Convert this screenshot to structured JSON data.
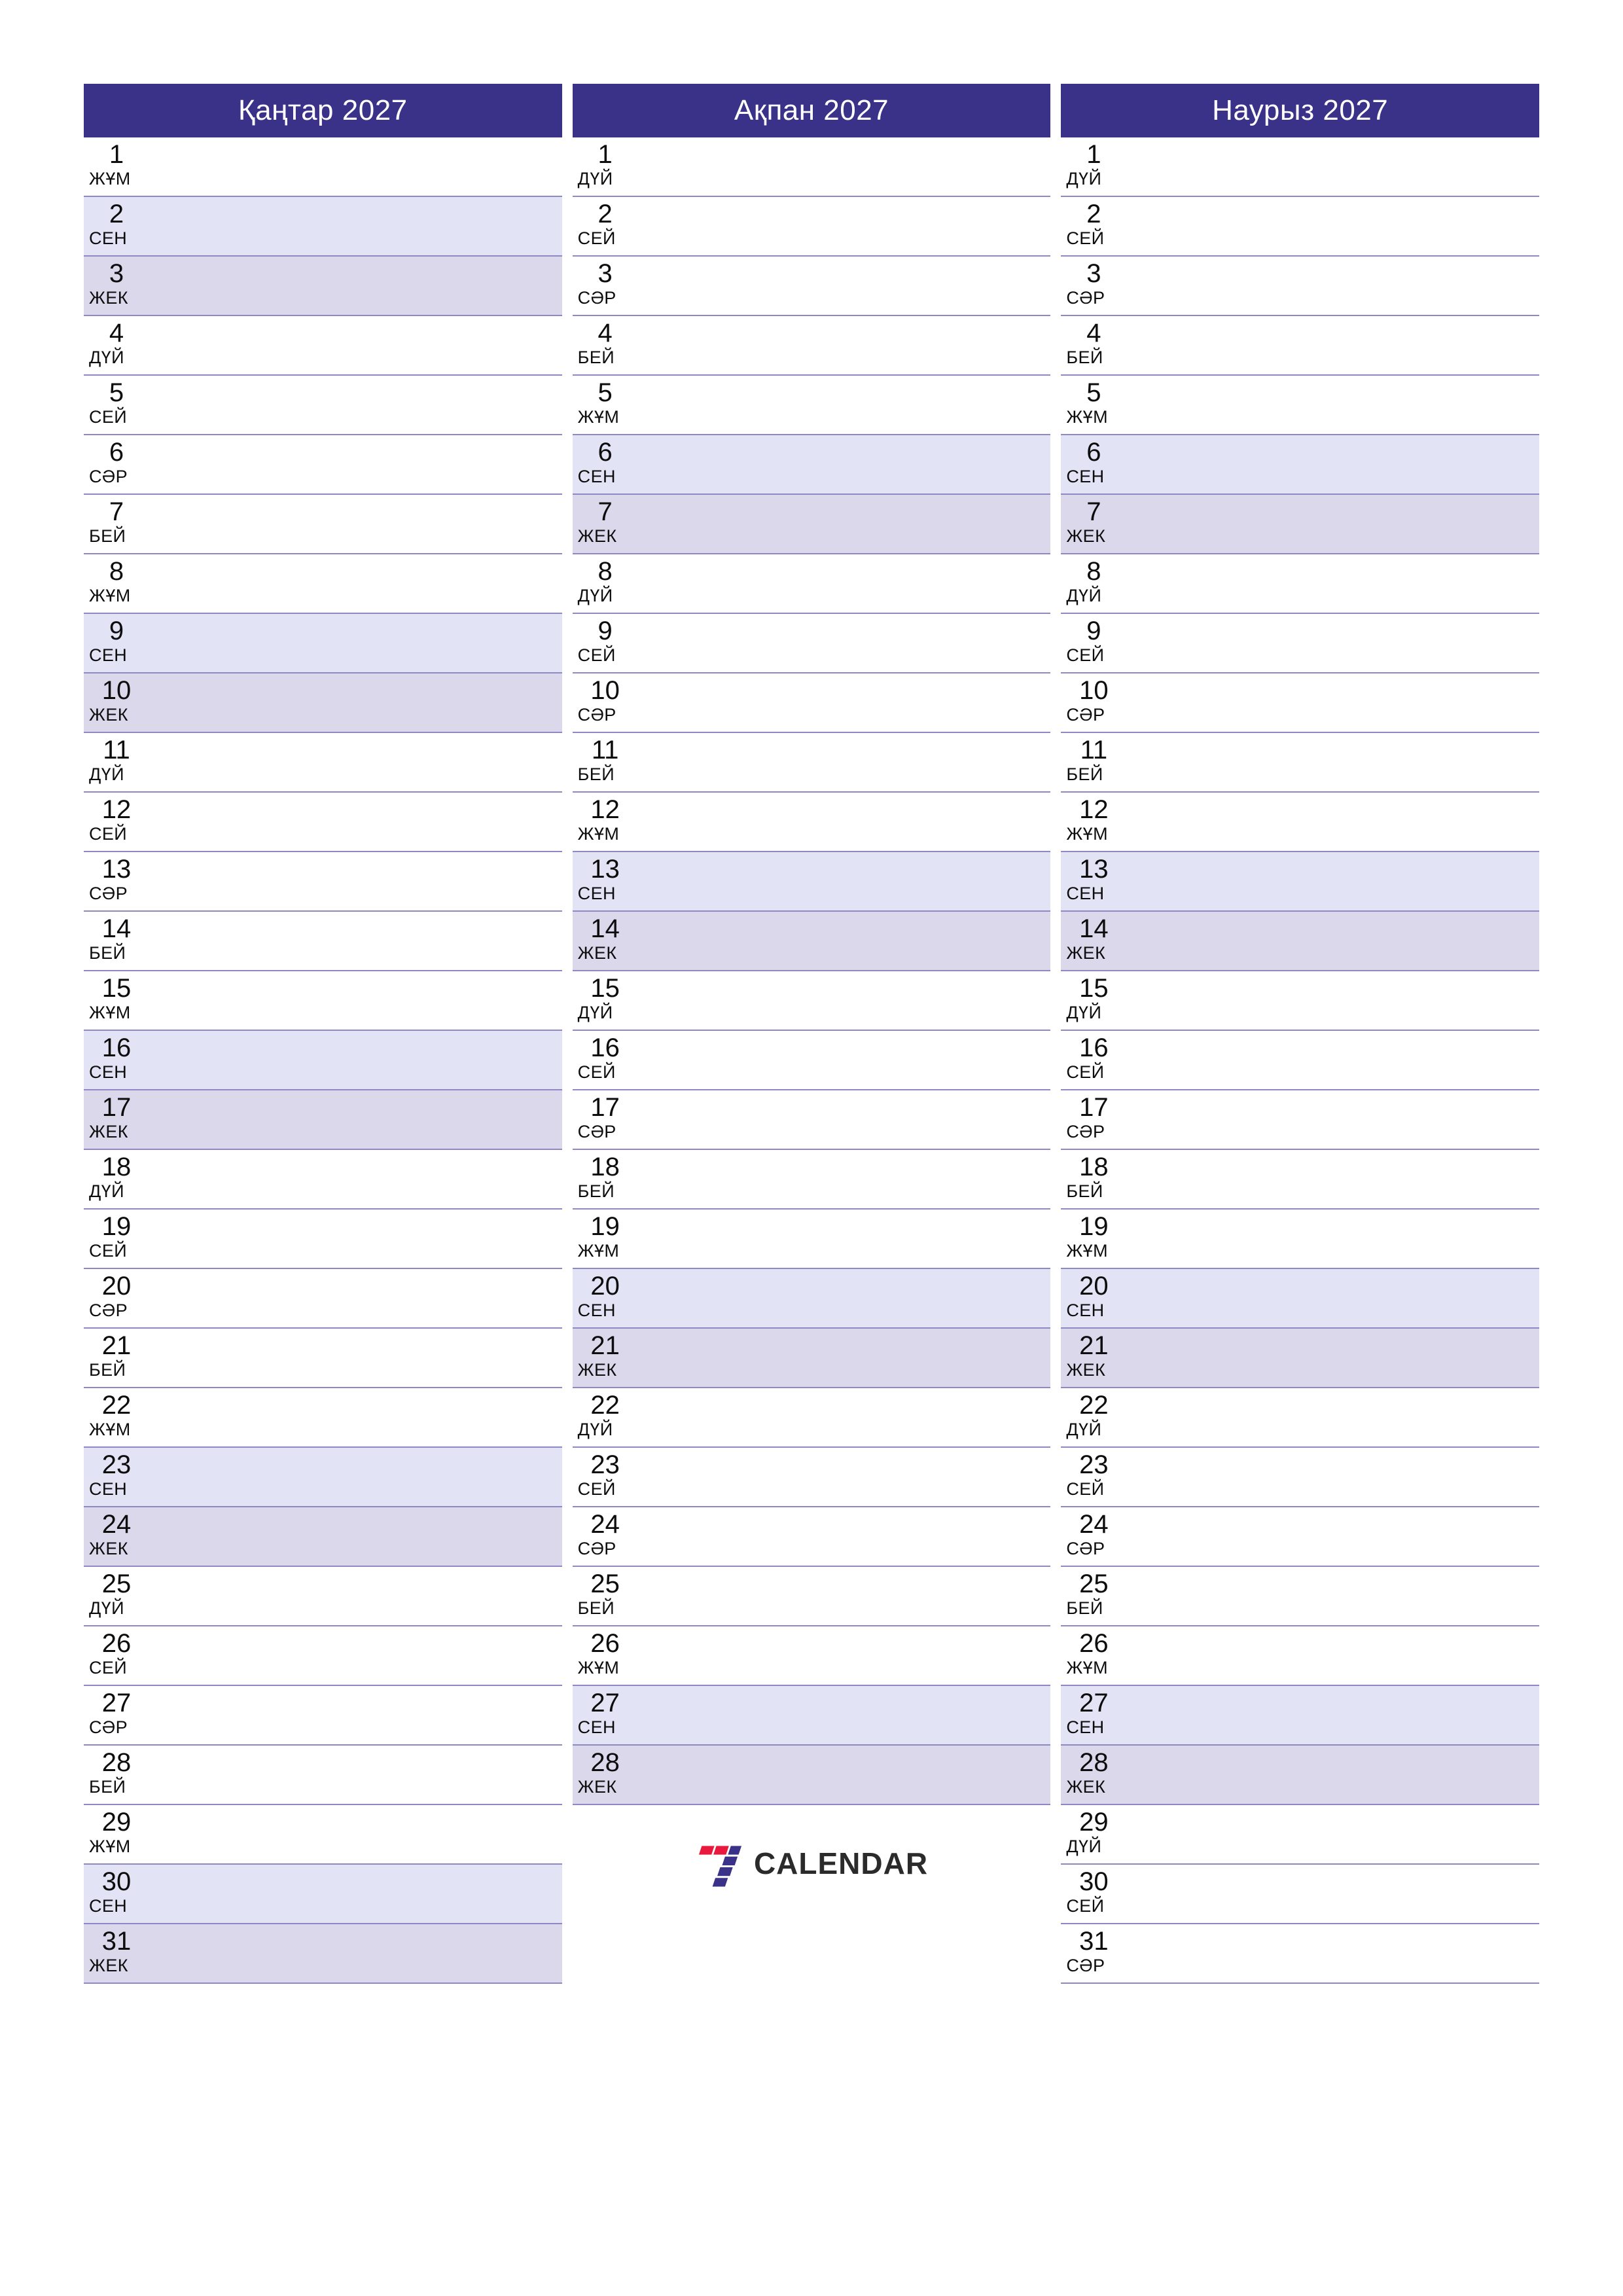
{
  "theme": {
    "header_bg": "#3a3189",
    "header_text": "#ffffff",
    "saturday_bg": "#e3e3f6",
    "sunday_bg": "#dcd8ec",
    "gridline": "#8e88c4",
    "day_text": "#0d0d0d",
    "logo_red": "#e8193c",
    "logo_purple": "#3a3189",
    "logo_text": "#2b2b2b"
  },
  "logo": {
    "mark_name": "seven-logo-mark",
    "text": "CALENDAR"
  },
  "weekday_names": {
    "mon": "ДҮЙ",
    "tue": "СЕЙ",
    "wed": "СӘР",
    "thu": "БЕЙ",
    "fri": "ЖҰМ",
    "sat": "СЕН",
    "sun": "ЖЕК"
  },
  "months": [
    {
      "id": "january",
      "title": "Қаңтар 2027",
      "days": [
        {
          "n": "1",
          "wd": "ЖҰМ",
          "type": "weekday"
        },
        {
          "n": "2",
          "wd": "СЕН",
          "type": "sat"
        },
        {
          "n": "3",
          "wd": "ЖЕК",
          "type": "sun"
        },
        {
          "n": "4",
          "wd": "ДҮЙ",
          "type": "weekday"
        },
        {
          "n": "5",
          "wd": "СЕЙ",
          "type": "weekday"
        },
        {
          "n": "6",
          "wd": "СӘР",
          "type": "weekday"
        },
        {
          "n": "7",
          "wd": "БЕЙ",
          "type": "weekday"
        },
        {
          "n": "8",
          "wd": "ЖҰМ",
          "type": "weekday"
        },
        {
          "n": "9",
          "wd": "СЕН",
          "type": "sat"
        },
        {
          "n": "10",
          "wd": "ЖЕК",
          "type": "sun"
        },
        {
          "n": "11",
          "wd": "ДҮЙ",
          "type": "weekday"
        },
        {
          "n": "12",
          "wd": "СЕЙ",
          "type": "weekday"
        },
        {
          "n": "13",
          "wd": "СӘР",
          "type": "weekday"
        },
        {
          "n": "14",
          "wd": "БЕЙ",
          "type": "weekday"
        },
        {
          "n": "15",
          "wd": "ЖҰМ",
          "type": "weekday"
        },
        {
          "n": "16",
          "wd": "СЕН",
          "type": "sat"
        },
        {
          "n": "17",
          "wd": "ЖЕК",
          "type": "sun"
        },
        {
          "n": "18",
          "wd": "ДҮЙ",
          "type": "weekday"
        },
        {
          "n": "19",
          "wd": "СЕЙ",
          "type": "weekday"
        },
        {
          "n": "20",
          "wd": "СӘР",
          "type": "weekday"
        },
        {
          "n": "21",
          "wd": "БЕЙ",
          "type": "weekday"
        },
        {
          "n": "22",
          "wd": "ЖҰМ",
          "type": "weekday"
        },
        {
          "n": "23",
          "wd": "СЕН",
          "type": "sat"
        },
        {
          "n": "24",
          "wd": "ЖЕК",
          "type": "sun"
        },
        {
          "n": "25",
          "wd": "ДҮЙ",
          "type": "weekday"
        },
        {
          "n": "26",
          "wd": "СЕЙ",
          "type": "weekday"
        },
        {
          "n": "27",
          "wd": "СӘР",
          "type": "weekday"
        },
        {
          "n": "28",
          "wd": "БЕЙ",
          "type": "weekday"
        },
        {
          "n": "29",
          "wd": "ЖҰМ",
          "type": "weekday"
        },
        {
          "n": "30",
          "wd": "СЕН",
          "type": "sat"
        },
        {
          "n": "31",
          "wd": "ЖЕК",
          "type": "sun"
        }
      ],
      "show_logo": false
    },
    {
      "id": "february",
      "title": "Ақпан 2027",
      "days": [
        {
          "n": "1",
          "wd": "ДҮЙ",
          "type": "weekday"
        },
        {
          "n": "2",
          "wd": "СЕЙ",
          "type": "weekday"
        },
        {
          "n": "3",
          "wd": "СӘР",
          "type": "weekday"
        },
        {
          "n": "4",
          "wd": "БЕЙ",
          "type": "weekday"
        },
        {
          "n": "5",
          "wd": "ЖҰМ",
          "type": "weekday"
        },
        {
          "n": "6",
          "wd": "СЕН",
          "type": "sat"
        },
        {
          "n": "7",
          "wd": "ЖЕК",
          "type": "sun"
        },
        {
          "n": "8",
          "wd": "ДҮЙ",
          "type": "weekday"
        },
        {
          "n": "9",
          "wd": "СЕЙ",
          "type": "weekday"
        },
        {
          "n": "10",
          "wd": "СӘР",
          "type": "weekday"
        },
        {
          "n": "11",
          "wd": "БЕЙ",
          "type": "weekday"
        },
        {
          "n": "12",
          "wd": "ЖҰМ",
          "type": "weekday"
        },
        {
          "n": "13",
          "wd": "СЕН",
          "type": "sat"
        },
        {
          "n": "14",
          "wd": "ЖЕК",
          "type": "sun"
        },
        {
          "n": "15",
          "wd": "ДҮЙ",
          "type": "weekday"
        },
        {
          "n": "16",
          "wd": "СЕЙ",
          "type": "weekday"
        },
        {
          "n": "17",
          "wd": "СӘР",
          "type": "weekday"
        },
        {
          "n": "18",
          "wd": "БЕЙ",
          "type": "weekday"
        },
        {
          "n": "19",
          "wd": "ЖҰМ",
          "type": "weekday"
        },
        {
          "n": "20",
          "wd": "СЕН",
          "type": "sat"
        },
        {
          "n": "21",
          "wd": "ЖЕК",
          "type": "sun"
        },
        {
          "n": "22",
          "wd": "ДҮЙ",
          "type": "weekday"
        },
        {
          "n": "23",
          "wd": "СЕЙ",
          "type": "weekday"
        },
        {
          "n": "24",
          "wd": "СӘР",
          "type": "weekday"
        },
        {
          "n": "25",
          "wd": "БЕЙ",
          "type": "weekday"
        },
        {
          "n": "26",
          "wd": "ЖҰМ",
          "type": "weekday"
        },
        {
          "n": "27",
          "wd": "СЕН",
          "type": "sat"
        },
        {
          "n": "28",
          "wd": "ЖЕК",
          "type": "sun"
        }
      ],
      "show_logo": true
    },
    {
      "id": "march",
      "title": "Наурыз 2027",
      "days": [
        {
          "n": "1",
          "wd": "ДҮЙ",
          "type": "weekday"
        },
        {
          "n": "2",
          "wd": "СЕЙ",
          "type": "weekday"
        },
        {
          "n": "3",
          "wd": "СӘР",
          "type": "weekday"
        },
        {
          "n": "4",
          "wd": "БЕЙ",
          "type": "weekday"
        },
        {
          "n": "5",
          "wd": "ЖҰМ",
          "type": "weekday"
        },
        {
          "n": "6",
          "wd": "СЕН",
          "type": "sat"
        },
        {
          "n": "7",
          "wd": "ЖЕК",
          "type": "sun"
        },
        {
          "n": "8",
          "wd": "ДҮЙ",
          "type": "weekday"
        },
        {
          "n": "9",
          "wd": "СЕЙ",
          "type": "weekday"
        },
        {
          "n": "10",
          "wd": "СӘР",
          "type": "weekday"
        },
        {
          "n": "11",
          "wd": "БЕЙ",
          "type": "weekday"
        },
        {
          "n": "12",
          "wd": "ЖҰМ",
          "type": "weekday"
        },
        {
          "n": "13",
          "wd": "СЕН",
          "type": "sat"
        },
        {
          "n": "14",
          "wd": "ЖЕК",
          "type": "sun"
        },
        {
          "n": "15",
          "wd": "ДҮЙ",
          "type": "weekday"
        },
        {
          "n": "16",
          "wd": "СЕЙ",
          "type": "weekday"
        },
        {
          "n": "17",
          "wd": "СӘР",
          "type": "weekday"
        },
        {
          "n": "18",
          "wd": "БЕЙ",
          "type": "weekday"
        },
        {
          "n": "19",
          "wd": "ЖҰМ",
          "type": "weekday"
        },
        {
          "n": "20",
          "wd": "СЕН",
          "type": "sat"
        },
        {
          "n": "21",
          "wd": "ЖЕК",
          "type": "sun"
        },
        {
          "n": "22",
          "wd": "ДҮЙ",
          "type": "weekday"
        },
        {
          "n": "23",
          "wd": "СЕЙ",
          "type": "weekday"
        },
        {
          "n": "24",
          "wd": "СӘР",
          "type": "weekday"
        },
        {
          "n": "25",
          "wd": "БЕЙ",
          "type": "weekday"
        },
        {
          "n": "26",
          "wd": "ЖҰМ",
          "type": "weekday"
        },
        {
          "n": "27",
          "wd": "СЕН",
          "type": "sat"
        },
        {
          "n": "28",
          "wd": "ЖЕК",
          "type": "sun"
        },
        {
          "n": "29",
          "wd": "ДҮЙ",
          "type": "weekday"
        },
        {
          "n": "30",
          "wd": "СЕЙ",
          "type": "weekday"
        },
        {
          "n": "31",
          "wd": "СӘР",
          "type": "weekday"
        }
      ],
      "show_logo": false
    }
  ]
}
